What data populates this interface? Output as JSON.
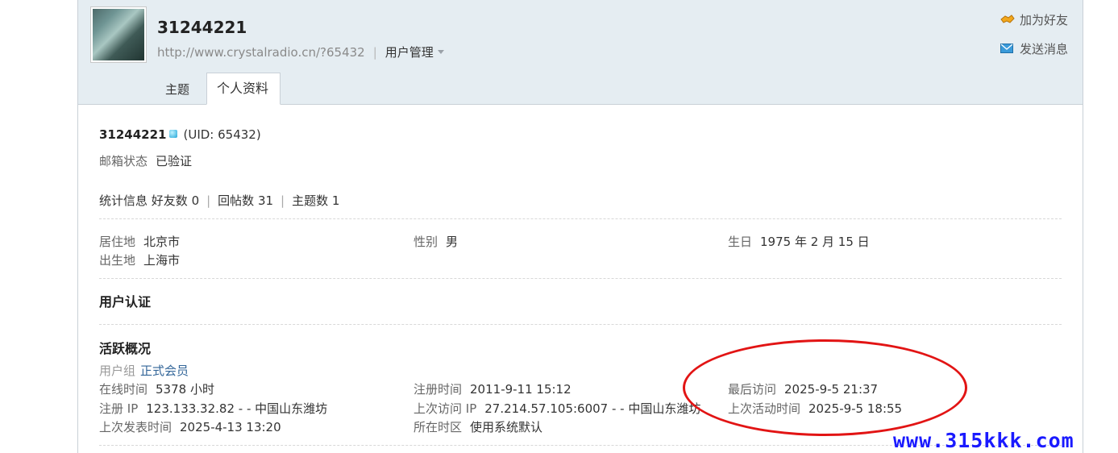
{
  "header": {
    "username": "31244221",
    "url": "http://www.crystalradio.cn/?65432",
    "manage_label": "用户管理",
    "add_friend": "加为好友",
    "send_message": "发送消息"
  },
  "tabs": [
    {
      "label": "主题"
    },
    {
      "label": "个人资料"
    }
  ],
  "profile": {
    "name": "31244221",
    "uid": "(UID: 65432)",
    "email_label": "邮箱状态",
    "email_value": "已验证",
    "stats_label": "统计信息",
    "friends": "好友数 0",
    "replies": "回帖数 31",
    "topics": "主题数 1",
    "residence_label": "居住地",
    "residence_value": "北京市",
    "birthplace_label": "出生地",
    "birthplace_value": "上海市",
    "gender_label": "性别",
    "gender_value": "男",
    "birthday_label": "生日",
    "birthday_value": "1975 年 2 月 15 日",
    "auth_title": "用户认证",
    "activity_title": "活跃概况",
    "group_label": "用户组",
    "group_value": "正式会员",
    "online_label": "在线时间",
    "online_value": "5378 小时",
    "reg_time_label": "注册时间",
    "reg_time_value": "2011-9-11 15:12",
    "last_visit_label": "最后访问",
    "last_visit_value": "2025-9-5 21:37",
    "reg_ip_label": "注册 IP",
    "reg_ip_value": "123.133.32.82 - - 中国山东潍坊",
    "last_ip_label": "上次访问 IP",
    "last_ip_value": "27.214.57.105:6007 - - 中国山东潍坊",
    "last_active_label": "上次活动时间",
    "last_active_value": "2025-9-5 18:55",
    "last_post_label": "上次发表时间",
    "last_post_value": "2025-4-13 13:20",
    "timezone_label": "所在时区",
    "timezone_value": "使用系统默认"
  },
  "watermark": "www.315kkk.com"
}
